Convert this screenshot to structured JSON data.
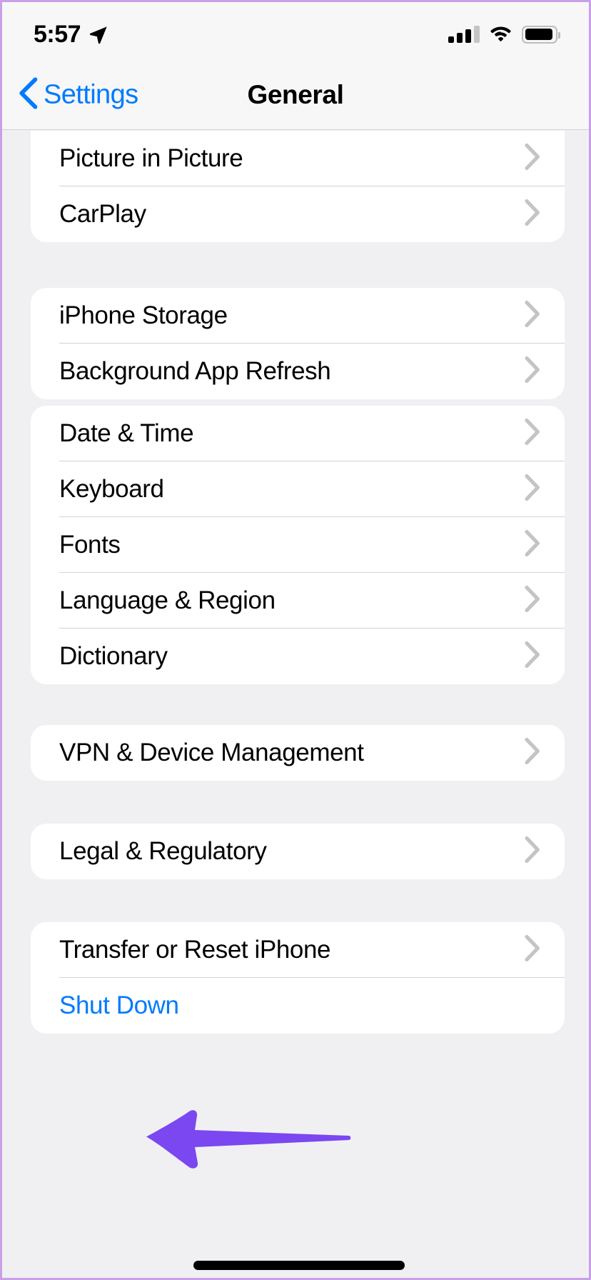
{
  "status_bar": {
    "time": "5:57",
    "location_icon": "location-arrow-icon",
    "cellular_icon": "cellular-signal-icon",
    "cellular_bars_filled": 3,
    "cellular_bars_total": 4,
    "wifi_icon": "wifi-icon",
    "battery_icon": "battery-icon",
    "battery_level_percent": 80
  },
  "nav_bar": {
    "back_label": "Settings",
    "back_icon": "chevron-left-icon",
    "title": "General"
  },
  "colors": {
    "accent_blue": "#007AFF",
    "page_background": "#F0F0F3",
    "card_background": "#FFFFFF",
    "separator": "#D3D3D5",
    "chevron": "#C4C4C6",
    "annotation_purple": "#7B47F0",
    "frame_border": "#C9A0E8"
  },
  "groups": [
    {
      "id": "media-group",
      "clipped_top": true,
      "rows": [
        {
          "label": "Picture in Picture",
          "accessory": "chevron-right-icon",
          "style": "default"
        },
        {
          "label": "CarPlay",
          "accessory": "chevron-right-icon",
          "style": "default"
        }
      ]
    },
    {
      "id": "storage-group",
      "clipped_top": false,
      "rows": [
        {
          "label": "iPhone Storage",
          "accessory": "chevron-right-icon",
          "style": "default"
        },
        {
          "label": "Background App Refresh",
          "accessory": "chevron-right-icon",
          "style": "default"
        }
      ]
    },
    {
      "id": "localization-group",
      "clipped_top": false,
      "rows": [
        {
          "label": "Date & Time",
          "accessory": "chevron-right-icon",
          "style": "default"
        },
        {
          "label": "Keyboard",
          "accessory": "chevron-right-icon",
          "style": "default"
        },
        {
          "label": "Fonts",
          "accessory": "chevron-right-icon",
          "style": "default"
        },
        {
          "label": "Language & Region",
          "accessory": "chevron-right-icon",
          "style": "default"
        },
        {
          "label": "Dictionary",
          "accessory": "chevron-right-icon",
          "style": "default"
        }
      ]
    },
    {
      "id": "vpn-group",
      "clipped_top": false,
      "rows": [
        {
          "label": "VPN & Device Management",
          "accessory": "chevron-right-icon",
          "style": "default"
        }
      ]
    },
    {
      "id": "legal-group",
      "clipped_top": false,
      "rows": [
        {
          "label": "Legal & Regulatory",
          "accessory": "chevron-right-icon",
          "style": "default"
        }
      ]
    },
    {
      "id": "reset-group",
      "clipped_top": false,
      "rows": [
        {
          "label": "Transfer or Reset iPhone",
          "accessory": "chevron-right-icon",
          "style": "default"
        },
        {
          "label": "Shut Down",
          "accessory": "none",
          "style": "link"
        }
      ]
    }
  ],
  "annotation": {
    "type": "arrow",
    "direction": "left",
    "points_at": "Shut Down",
    "color": "#7B47F0"
  },
  "home_indicator": {
    "visible": true
  }
}
